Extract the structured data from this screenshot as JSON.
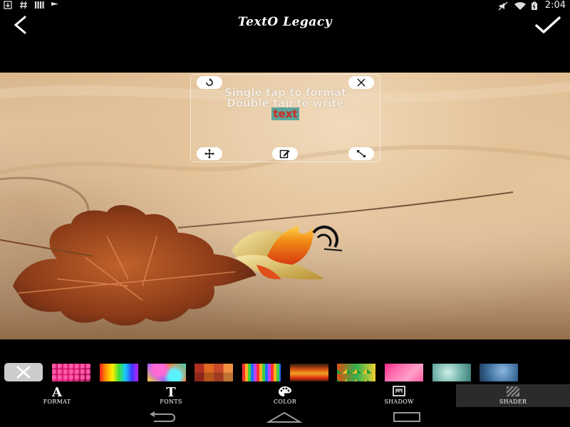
{
  "status_bar": {
    "left_icons": [
      "download-icon",
      "hashtag-icon",
      "bars-icon",
      "flag-icon"
    ],
    "right_icons": [
      "mute-icon",
      "wifi-icon",
      "battery-icon"
    ],
    "time": "2:04"
  },
  "app_bar": {
    "title": "TextO Legacy",
    "back_icon": "back-arrow-icon",
    "confirm_icon": "checkmark-icon"
  },
  "text_box": {
    "line1": "Single tap to format",
    "line2": "Double tap to write",
    "line3": "text",
    "handles": [
      "rotate-icon",
      "close-icon",
      "move-icon",
      "edit-icon",
      "resize-icon"
    ]
  },
  "shader_swatches": {
    "clear_icon": "close-icon",
    "items": [
      "swatch-glitter",
      "swatch-rainbow",
      "swatch-swirl",
      "swatch-tiles",
      "swatch-stripes",
      "swatch-warm-waves",
      "swatch-triangles",
      "swatch-pink-mosaic",
      "swatch-aqua-texture",
      "swatch-blue-texture"
    ]
  },
  "tabs": [
    {
      "label": "FORMAT",
      "icon": "letter-a-icon",
      "active": false
    },
    {
      "label": "FONTS",
      "icon": "letter-t-icon",
      "active": false
    },
    {
      "label": "COLOR",
      "icon": "palette-icon",
      "active": false
    },
    {
      "label": "SHADOW",
      "icon": "shadow-image-icon",
      "active": false
    },
    {
      "label": "SHADER",
      "icon": "shader-stripes-icon",
      "active": true
    }
  ],
  "nav_bar": {
    "buttons": [
      "back-nav-icon",
      "home-nav-icon",
      "recents-nav-icon"
    ]
  },
  "colors": {
    "accent": "#5da59c",
    "highlight_text": "#c9302c",
    "active_tab": "#2b2b2b"
  }
}
